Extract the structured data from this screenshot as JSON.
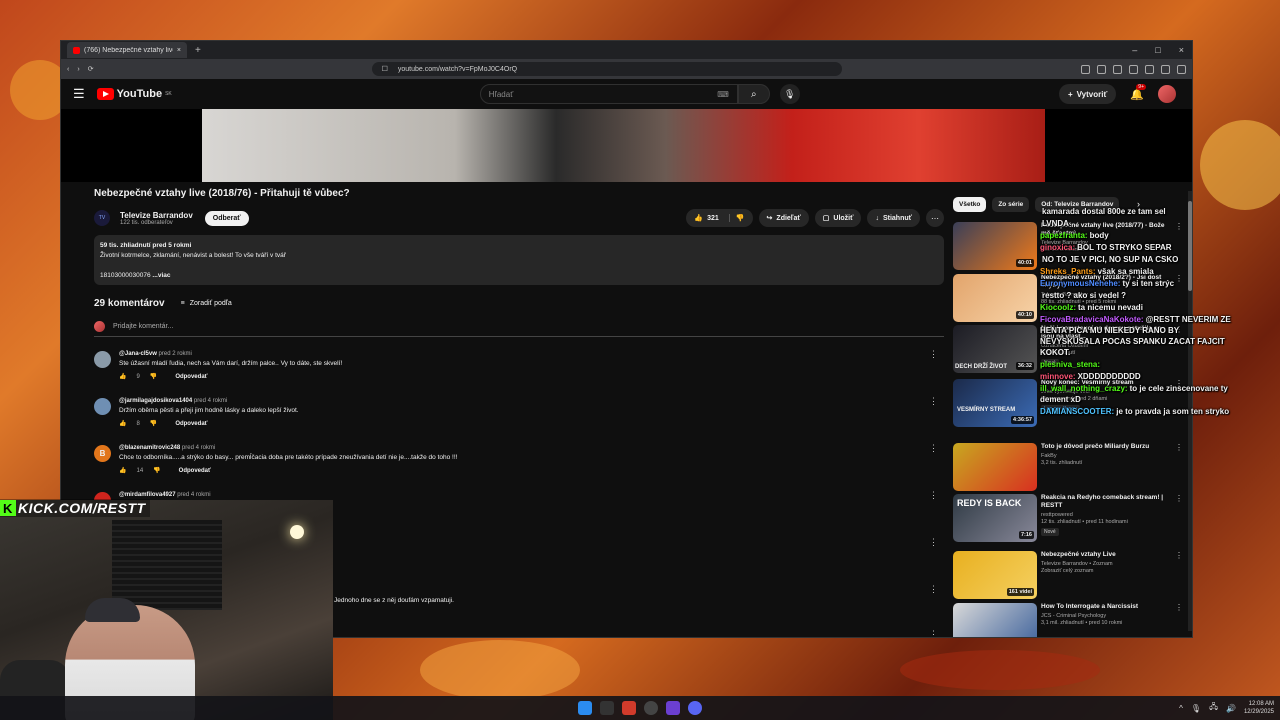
{
  "browser": {
    "tab_title": "(766) Nebezpečné vztahy live (2...",
    "url": "youtube.com/watch?v=FpMoJ0C4OrQ"
  },
  "header": {
    "logo": "YouTube",
    "logo_region": "SK",
    "search_placeholder": "Hľadať",
    "create_label": "Vytvoriť",
    "notif_count": "9+"
  },
  "video": {
    "title": "Nebezpečné vztahy live (2018/76) - Přitahuji tě vůbec?",
    "channel": "Televize Barrandov",
    "subscribers": "122 tis. odberateľov",
    "subscribe_label": "Odberať",
    "likes": "321",
    "share_label": "Zdieľať",
    "save_label": "Uložiť",
    "download_label": "Stiahnuť"
  },
  "description": {
    "meta": "59 tis. zhliadnutí  pred 5 rokmi",
    "line1": "Životní kotrmelce, zklamání, nenávist a bolest! To vše tváří v tvář",
    "line2": "18103000030076 ",
    "more": "...viac"
  },
  "comments": {
    "count_label": "29 komentárov",
    "sort_label": "Zoradiť podľa",
    "add_placeholder": "Pridajte komentár...",
    "items": [
      {
        "author": "@Jana-cl5vw",
        "when": "pred 2 rokmi",
        "text": "Ste úžasní mladí ľudia, nech sa Vám darí, držím palce.. Vy to dáte, ste skvelí!",
        "likes": "9",
        "reply": "Odpovedať",
        "color": "#8a9aa8"
      },
      {
        "author": "@jarmilagajdosikova1404",
        "when": "pred 4 rokmi",
        "text": "Držím oběma pěsti a přeji jim hodně lásky a daleko lepší život.",
        "likes": "8",
        "reply": "Odpovedať",
        "color": "#6f8fb3"
      },
      {
        "author": "@blazenamitrovic248",
        "when": "pred 4 rokmi",
        "text": "Chce to odborníka.....a strýko do basy... premĺčacia doba pre takéto prípade zneužívania detí nie je....takže do toho !!!",
        "likes": "14",
        "reply": "Odpovedať",
        "color": "#e2761b",
        "initial": "B"
      },
      {
        "author": "@mirdamfilova4927",
        "when": "pred 4 rokmi",
        "text": "",
        "likes": "",
        "reply": "",
        "color": "#d0241d"
      }
    ],
    "trailing_text": "Jednoho dne se z něj doufám vzpamatuji."
  },
  "sidebar": {
    "chips": [
      "Všetko",
      "Zo série",
      "Od: Televize Barrandov"
    ],
    "items": [
      {
        "title": "Nebezpečné vztahy live (2018/77) - Bože mě šťastný...",
        "meta1": "Televize Barrandov",
        "meta2": "130 tis. zhliadnutí",
        "duration": "40:01",
        "thumb": "#3a3f58"
      },
      {
        "title": "Nebezpečné vztahy (2018/2?) - Jsi dost chytrý?",
        "meta1": "Televize Barrandov",
        "meta2": "88 tis. zhliadnutí • pred 5 rokmi",
        "duration": "40:10",
        "thumb": "#e2a46b"
      },
      {
        "title": "Naši j pomstoucí se dcerou netušila co jsou na vlast...",
        "meta1": "Označena Osudem",
        "meta2": "185 zhliadnutí",
        "duration": "36:32",
        "thumb": "#1c1c24",
        "badge": "Nové",
        "overlay": "DECH DRŽÍ ŽIVOT"
      },
      {
        "title": "Nový konec: Vesmírny stream",
        "meta1": "Jirka vysvětluje věci",
        "meta2": "Streamované pred 2 dňami",
        "duration": "4:36:57",
        "thumb": "#1b2a4a",
        "overlay": "VESMÍRNY STREAM",
        "badge": "Len pre členov"
      },
      {
        "title": "Toto je dôvod prečo Miliardy Burzu",
        "meta1": "FakBy",
        "meta2": "3,2 tis. zhliadnutí",
        "duration": "",
        "thumb": "#c8a820"
      },
      {
        "title": "Reakcia na Redyho comeback stream! | RESTT",
        "meta1": "resttpowered",
        "meta2": "12 tis. zhliadnutí • pred 11 hodinami",
        "duration": "7:16",
        "thumb": "#2f3a44",
        "badge": "Nové",
        "overlay": "REDY IS BACK"
      },
      {
        "title": "Nebezpečné vztahy Live",
        "meta1": "Televize Barrandov • Zoznam",
        "meta2": "Zobraziť celý zoznam",
        "duration": "161 videí",
        "thumb": "#e8b020"
      },
      {
        "title": "How To Interrogate a Narcissist",
        "meta1": "JCS - Criminal Psychology",
        "meta2": "3,1 mil. zhliadnutí • pred 10 rokmi",
        "duration": "",
        "thumb": "#d9d9d9"
      }
    ]
  },
  "chat": [
    {
      "user": "",
      "color": "#ffffff",
      "text": "kamarada dostal 800e ze tam sel"
    },
    {
      "user": "",
      "color": "#ffffff",
      "text": "LVNDA"
    },
    {
      "user": "papezfranta:",
      "color": "#53fc18",
      "text": "body"
    },
    {
      "user": "ginoxica:",
      "color": "#ff5577",
      "text": "BOL TO STRYKO SEPAR"
    },
    {
      "user": "",
      "color": "#ffffff",
      "text": "NO TO JE V PICI, NO SUP NA CSKO"
    },
    {
      "user": "Shreks_Pants:",
      "color": "#ff9f1a",
      "text": "však sa smiala"
    },
    {
      "user": "EuronymousNehehe:",
      "color": "#4f8cff",
      "text": "ty si ten strýc"
    },
    {
      "user": "",
      "color": "#ffffff",
      "text": "restto ? ako si vedel ?"
    },
    {
      "user": "Kiocoolz:",
      "color": "#53fc18",
      "text": "ta nicemu nevadi"
    },
    {
      "user": "FicovaBradavicaNaKokote:",
      "color": "#c45cff",
      "text": "@RESTT NEVERIM ZE HENTA PICA MU NIEKEDY RANO BY NEVYSKUSALA POCAS SPANKU ZACAT FAJCIT KOKOT."
    },
    {
      "user": "plesniva_stena:",
      "color": "#53fc18",
      "text": ""
    },
    {
      "user": "minnove:",
      "color": "#ff5577",
      "text": "XDDDDDDDDDD"
    },
    {
      "user": "ill_wall_nothing_crazy:",
      "color": "#53fc18",
      "text": "to je cele zinscenovane ty dement xD"
    },
    {
      "user": "DAMIANSCOOTER:",
      "color": "#4fc3ff",
      "text": "je to pravda ja som ten stryko"
    }
  ],
  "overlay": {
    "kick_label": "KICK.COM/RESTT"
  },
  "taskbar": {
    "time": "12:08 AM",
    "date": "12/29/2025"
  }
}
